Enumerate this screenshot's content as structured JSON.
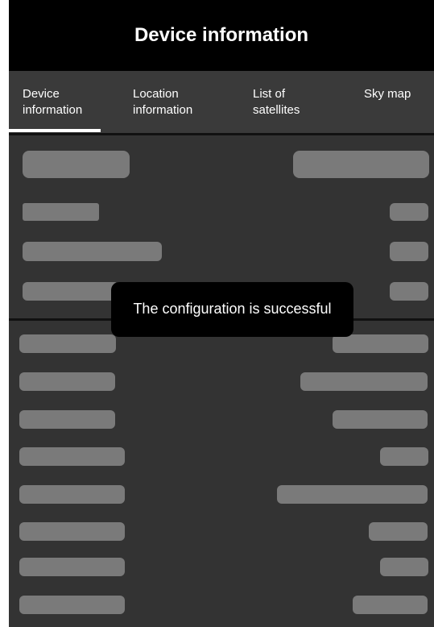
{
  "header": {
    "title": "Device information"
  },
  "tabs": [
    {
      "label": "Device\ninformation",
      "active": true
    },
    {
      "label": "Location\ninformation",
      "active": false
    },
    {
      "label": "List of\nsatellites",
      "active": false
    },
    {
      "label": "Sky map",
      "active": false
    }
  ],
  "toast": {
    "message": "The configuration is successful"
  },
  "colors": {
    "header_bg": "#000000",
    "screen_bg": "#333333",
    "placeholder": "#7a7a7a",
    "text": "#ffffff"
  }
}
